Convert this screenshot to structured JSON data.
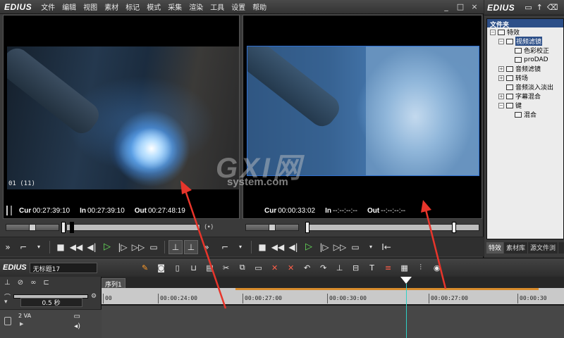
{
  "app": {
    "logo": "EDIUS",
    "menu": [
      "文件",
      "编辑",
      "视图",
      "素材",
      "标记",
      "模式",
      "采集",
      "渲染",
      "工具",
      "设置",
      "帮助"
    ],
    "window_controls": [
      "_",
      "□",
      "×"
    ]
  },
  "player": {
    "timecode_overlay": "01 (11)",
    "cur_label": "Cur",
    "cur_value": "00:27:39:10",
    "in_label": "In",
    "in_value": "00:27:39:10",
    "out_label": "Out",
    "out_value": "00:27:48:19"
  },
  "recorder": {
    "cur_label": "Cur",
    "cur_value": "00:00:33:02",
    "in_label": "In",
    "in_value": "--:--:--:--",
    "out_label": "Out",
    "out_value": "--:--:--:--"
  },
  "palette": {
    "logo": "EDIUS",
    "folder_title": "文件夹",
    "tree": [
      {
        "label": "特效",
        "expand": "−",
        "indent": 0,
        "selected": false
      },
      {
        "label": "视频滤镜",
        "expand": "−",
        "indent": 1,
        "selected": true
      },
      {
        "label": "色彩校正",
        "expand": "",
        "indent": 2,
        "selected": false
      },
      {
        "label": "proDAD",
        "expand": "",
        "indent": 2,
        "selected": false
      },
      {
        "label": "音频滤镜",
        "expand": "+",
        "indent": 1,
        "selected": false
      },
      {
        "label": "转场",
        "expand": "+",
        "indent": 1,
        "selected": false
      },
      {
        "label": "音频淡入淡出",
        "expand": "",
        "indent": 1,
        "selected": false
      },
      {
        "label": "字幕混合",
        "expand": "+",
        "indent": 1,
        "selected": false
      },
      {
        "label": "键",
        "expand": "−",
        "indent": 1,
        "selected": false
      },
      {
        "label": "混合",
        "expand": "",
        "indent": 2,
        "selected": false
      }
    ],
    "tabs": [
      "特效",
      "素材库",
      "源文件浏"
    ]
  },
  "timeline": {
    "logo": "EDIUS",
    "project_name": "无标题17",
    "sequence_tab": "序列1",
    "scale": "0.5 秒",
    "ruler_ticks": [
      "00",
      "00:00:24:00",
      "00:00:27:00",
      "00:00:30:00",
      "00:00:27:00",
      "00:00:30"
    ],
    "track_name": "2 VA"
  },
  "watermark": {
    "main": "GXI网",
    "sub": "system.com"
  },
  "colors": {
    "play_green": "#66e05a",
    "selection_blue": "#2d4f88",
    "annotation_red": "#e8352b",
    "playhead_cyan": "#2fd0c5"
  }
}
